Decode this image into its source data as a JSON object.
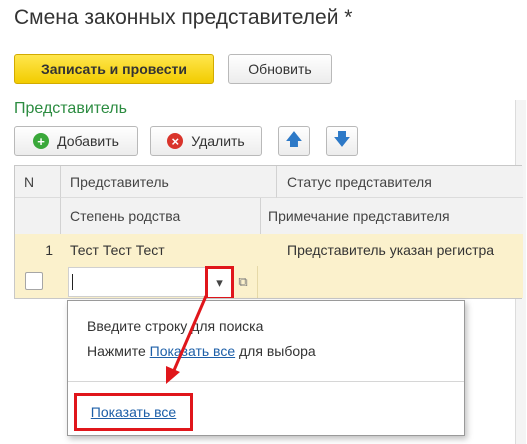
{
  "window": {
    "title": "Смена законных представителей *"
  },
  "toolbar": {
    "primary_label": "Записать и провести",
    "refresh_label": "Обновить"
  },
  "section": {
    "label": "Представитель"
  },
  "table_toolbar": {
    "add_label": "Добавить",
    "delete_label": "Удалить",
    "add_glyph": "+",
    "delete_glyph": "×",
    "up_glyph": "🡅",
    "down_glyph": "🡇"
  },
  "table": {
    "headers": {
      "n": "N",
      "representative": "Представитель",
      "status": "Статус представителя",
      "relation": "Степень родства",
      "note": "Примечание представителя"
    },
    "rows": [
      {
        "n": "1",
        "representative": "Тест Тест Тест",
        "status": "Представитель указан регистра"
      }
    ],
    "new_row": {
      "input_value": "",
      "dropdown_glyph": "▾",
      "open_glyph": "⧉"
    }
  },
  "dropdown_popup": {
    "hint_line1": "Введите строку для поиска",
    "hint_line2_prefix": "Нажмите ",
    "hint_line2_link": "Показать все",
    "hint_line2_suffix": " для выбора",
    "show_all_link": "Показать все"
  },
  "colors": {
    "primary_button": "#f2cc00",
    "section_label": "#2c8c41",
    "selected_row": "#fbf1cc",
    "highlight": "#e0161b",
    "link": "#1d5fa8"
  }
}
